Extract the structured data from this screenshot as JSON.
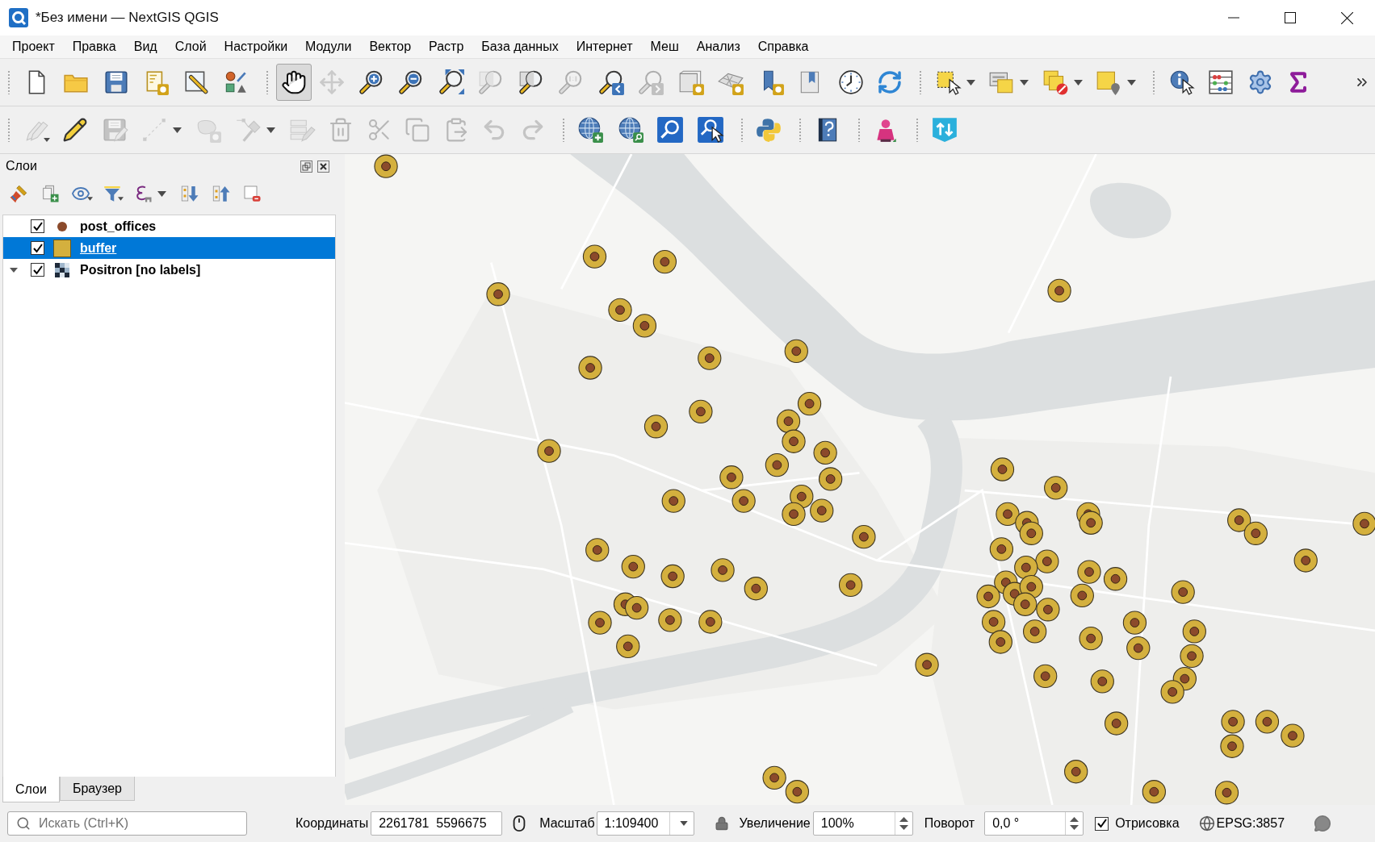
{
  "window": {
    "title": "*Без имени — NextGIS QGIS"
  },
  "menu": [
    "Проект",
    "Правка",
    "Вид",
    "Слой",
    "Настройки",
    "Модули",
    "Вектор",
    "Растр",
    "База данных",
    "Интернет",
    "Меш",
    "Анализ",
    "Справка"
  ],
  "toolbars": [
    {
      "groups": [
        {
          "buttons": [
            {
              "kind": "newfile",
              "disabled": false,
              "checked": false
            },
            {
              "kind": "open",
              "disabled": false,
              "checked": false
            },
            {
              "kind": "save",
              "disabled": false,
              "checked": false
            },
            {
              "kind": "layout",
              "disabled": false,
              "checked": false
            },
            {
              "kind": "layouts",
              "disabled": false,
              "checked": false
            },
            {
              "kind": "style",
              "disabled": false,
              "checked": false
            }
          ]
        },
        {
          "buttons": [
            {
              "kind": "pan",
              "disabled": false,
              "checked": true
            },
            {
              "kind": "pansel",
              "disabled": true,
              "checked": false
            },
            {
              "kind": "zoomin",
              "disabled": false,
              "checked": false
            },
            {
              "kind": "zoomout",
              "disabled": false,
              "checked": false
            },
            {
              "kind": "zoomfull",
              "disabled": false,
              "checked": false
            },
            {
              "kind": "zoomsel",
              "disabled": true,
              "checked": false
            },
            {
              "kind": "zoomlayer",
              "disabled": false,
              "checked": false
            },
            {
              "kind": "zoomnative",
              "disabled": true,
              "checked": false
            },
            {
              "kind": "zoomlast",
              "disabled": false,
              "checked": false
            },
            {
              "kind": "zoomnext",
              "disabled": true,
              "checked": false
            },
            {
              "kind": "mapview",
              "disabled": false,
              "checked": false
            },
            {
              "kind": "map3d",
              "disabled": false,
              "checked": false
            },
            {
              "kind": "bookmark",
              "disabled": false,
              "checked": false
            },
            {
              "kind": "bookmarks",
              "disabled": false,
              "checked": false
            },
            {
              "kind": "temporal",
              "disabled": false,
              "checked": false
            },
            {
              "kind": "refresh",
              "disabled": false,
              "checked": false
            }
          ]
        },
        {
          "buttons": [
            {
              "kind": "select",
              "disabled": false,
              "checked": false
            },
            {
              "kind": "selattr",
              "disabled": false,
              "checked": false
            },
            {
              "kind": "deselect",
              "disabled": false,
              "checked": false
            },
            {
              "kind": "selloc",
              "disabled": false,
              "checked": false
            }
          ]
        },
        {
          "buttons": [
            {
              "kind": "identify",
              "disabled": false,
              "checked": false
            },
            {
              "kind": "statistics",
              "disabled": false,
              "checked": false
            },
            {
              "kind": "processing",
              "disabled": false,
              "checked": false
            },
            {
              "kind": "summary",
              "disabled": false,
              "checked": false
            }
          ]
        }
      ]
    },
    {
      "groups": [
        {
          "buttons": [
            {
              "kind": "edits",
              "disabled": true,
              "checked": false
            },
            {
              "kind": "toggleedit",
              "disabled": false,
              "checked": false
            },
            {
              "kind": "saveedits",
              "disabled": true,
              "checked": false
            },
            {
              "kind": "line",
              "disabled": true,
              "checked": false
            },
            {
              "kind": "polygon",
              "disabled": true,
              "checked": false
            },
            {
              "kind": "vertex",
              "disabled": true,
              "checked": false
            },
            {
              "kind": "attrs",
              "disabled": true,
              "checked": false
            },
            {
              "kind": "delete",
              "disabled": true,
              "checked": false
            },
            {
              "kind": "cut",
              "disabled": true,
              "checked": false
            },
            {
              "kind": "copy",
              "disabled": true,
              "checked": false
            },
            {
              "kind": "paste",
              "disabled": true,
              "checked": false
            },
            {
              "kind": "undo",
              "disabled": true,
              "checked": false
            },
            {
              "kind": "redo",
              "disabled": true,
              "checked": false
            }
          ]
        },
        {
          "buttons": [
            {
              "kind": "wmsadd",
              "disabled": false,
              "checked": false
            },
            {
              "kind": "wmssearch",
              "disabled": false,
              "checked": false
            },
            {
              "kind": "searchtile",
              "disabled": false,
              "checked": false
            },
            {
              "kind": "identifytile",
              "disabled": false,
              "checked": false
            }
          ]
        },
        {
          "buttons": [
            {
              "kind": "python",
              "disabled": false,
              "checked": false
            }
          ]
        },
        {
          "buttons": [
            {
              "kind": "help",
              "disabled": false,
              "checked": false
            }
          ]
        },
        {
          "buttons": [
            {
              "kind": "figure",
              "disabled": false,
              "checked": false
            }
          ]
        },
        {
          "buttons": [
            {
              "kind": "sync",
              "disabled": false,
              "checked": false
            }
          ]
        }
      ]
    }
  ],
  "layers_panel": {
    "title": "Слои",
    "layers": [
      {
        "name": "post_offices",
        "kind": "point",
        "color": "#8b4a2b",
        "checked": true,
        "selected": false
      },
      {
        "name": "buffer",
        "kind": "polygon",
        "color": "#d4b03e",
        "checked": true,
        "selected": true
      },
      {
        "name": "Positron [no labels]",
        "kind": "raster",
        "checked": true,
        "selected": false,
        "expanded": true
      }
    ]
  },
  "dock_tabs": [
    {
      "label": "Слои",
      "selected": true
    },
    {
      "label": "Браузер",
      "selected": false
    }
  ],
  "status_bar": {
    "search": {
      "placeholder": "Искать (Ctrl+K)"
    },
    "coordinates": {
      "label": "Координаты",
      "value": "2261781  5596675"
    },
    "scale": {
      "label": "Масштаб",
      "value": "1:109400"
    },
    "magnification": {
      "label": "Увеличение",
      "value": "100%"
    },
    "rotation": {
      "label": "Поворот",
      "value": "0,0 °"
    },
    "render": {
      "label": "Отрисовка",
      "checked": true
    },
    "crs": "EPSG:3857"
  }
}
